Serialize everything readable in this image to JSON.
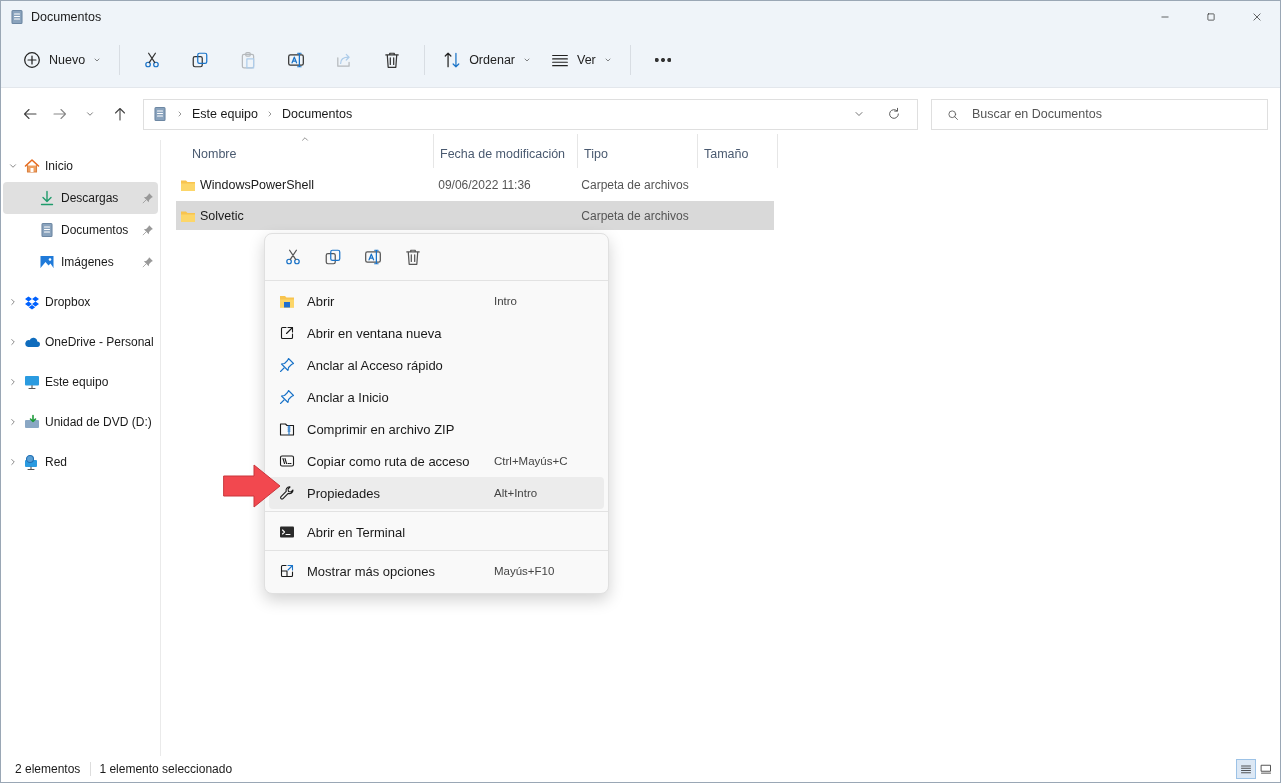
{
  "window": {
    "title": "Documentos"
  },
  "toolbar": [
    {
      "label": "Nuevo",
      "dropdown": true,
      "disabled": false
    },
    {
      "disabled": false
    },
    {
      "disabled": false
    },
    {
      "disabled": true
    },
    {
      "disabled": false
    },
    {
      "disabled": true
    },
    {
      "disabled": false
    },
    {
      "label": "Ordenar",
      "dropdown": true,
      "disabled": false
    },
    {
      "label": "Ver",
      "dropdown": true,
      "disabled": false
    },
    {
      "disabled": false
    }
  ],
  "address": {
    "breadcrumb": [
      "Este equipo",
      "Documentos"
    ]
  },
  "search": {
    "placeholder": "Buscar en Documentos"
  },
  "sidebar": {
    "items": [
      {
        "label": "Inicio",
        "expanded": true,
        "selected": false,
        "children": [
          {
            "label": "Descargas",
            "selected": true,
            "pinned": true
          },
          {
            "label": "Documentos",
            "selected": false,
            "pinned": true
          },
          {
            "label": "Imágenes",
            "selected": false,
            "pinned": true
          }
        ]
      },
      {
        "label": "Dropbox",
        "expanded": false,
        "selected": false
      },
      {
        "label": "OneDrive - Personal",
        "expanded": false,
        "selected": false
      },
      {
        "label": "Este equipo",
        "expanded": false,
        "selected": false
      },
      {
        "label": "Unidad de DVD (D:)",
        "expanded": false,
        "selected": false
      },
      {
        "label": "Red",
        "expanded": false,
        "selected": false
      }
    ]
  },
  "table": {
    "columns": [
      {
        "label": "Nombre",
        "sorted": true
      },
      {
        "label": "Fecha de modificación",
        "sorted": false
      },
      {
        "label": "Tipo",
        "sorted": false
      },
      {
        "label": "Tamaño",
        "sorted": false
      }
    ],
    "rows": [
      {
        "name": "WindowsPowerShell",
        "modified": "09/06/2022 11:36",
        "type": "Carpeta de archivos",
        "selected": false
      },
      {
        "name": "Solvetic",
        "type": "Carpeta de archivos",
        "selected": true
      }
    ]
  },
  "context_menu": {
    "sections": [
      [
        {
          "label": "Abrir",
          "shortcut": "Intro",
          "highlighted": false
        },
        {
          "label": "Abrir en ventana nueva",
          "highlighted": false
        },
        {
          "label": "Anclar al Acceso rápido",
          "highlighted": false
        },
        {
          "label": "Anclar a Inicio",
          "highlighted": false
        },
        {
          "label": "Comprimir en archivo ZIP",
          "highlighted": false
        },
        {
          "label": "Copiar como ruta de acceso",
          "shortcut": "Ctrl+Mayús+C",
          "highlighted": false
        },
        {
          "label": "Propiedades",
          "shortcut": "Alt+Intro",
          "highlighted": true
        }
      ],
      [
        {
          "label": "Abrir en Terminal",
          "highlighted": false
        }
      ],
      [
        {
          "label": "Mostrar más opciones",
          "shortcut": "Mayús+F10",
          "highlighted": false
        }
      ]
    ]
  },
  "status_bar": {
    "items": [
      "2 elementos",
      "1 elemento seleccionado"
    ],
    "views": [
      {
        "selected": true
      },
      {
        "selected": false
      }
    ]
  }
}
